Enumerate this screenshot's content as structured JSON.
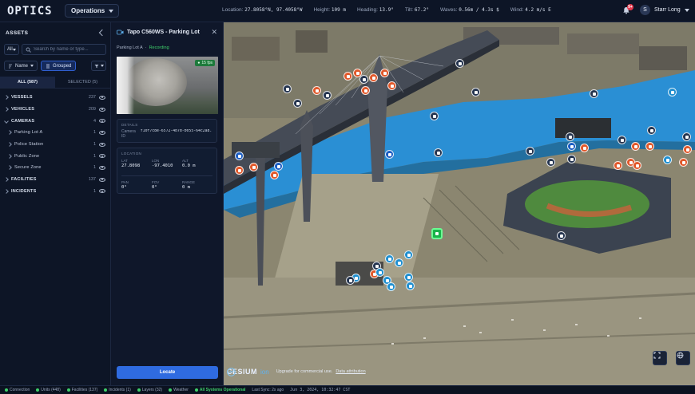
{
  "app": {
    "logo_text": "OPTICS",
    "operations_label": "Operations"
  },
  "telemetry": {
    "location_label": "Location:",
    "location_value": "27.8058°N, 97.4058°W",
    "height_label": "Height:",
    "height_value": "109 m",
    "heading_label": "Heading:",
    "heading_value": "13.9°",
    "tilt_label": "Tilt:",
    "tilt_value": "67.2°",
    "waves_label": "Waves:",
    "waves_value": "0.56m / 4.3s $",
    "wind_label": "Wind:",
    "wind_value": "4.2 m/s E"
  },
  "user": {
    "notification_count": "9+",
    "avatar_initial": "S",
    "name": "Starr Long"
  },
  "assets": {
    "title": "ASSETS",
    "filter_select": "All",
    "search_placeholder": "Search by name or type...",
    "sort_label": "Name",
    "grouped_label": "Grouped",
    "tabs": [
      {
        "label": "ALL (587)"
      },
      {
        "label": "SELECTED (5)"
      }
    ],
    "tree": [
      {
        "name": "VESSELS",
        "count": "237"
      },
      {
        "name": "VEHICLES",
        "count": "209"
      },
      {
        "name": "CAMERAS",
        "count": "4"
      },
      {
        "name": "Parking Lot A",
        "count": "1"
      },
      {
        "name": "Police Station",
        "count": "1"
      },
      {
        "name": "Public Zone",
        "count": "1"
      },
      {
        "name": "Secure Zone",
        "count": "1"
      },
      {
        "name": "FACILITIES",
        "count": "137"
      },
      {
        "name": "INCIDENTS",
        "count": "1"
      }
    ]
  },
  "camera": {
    "title": "Tapo C560WS - Parking Lot",
    "location": "Parking Lot A",
    "status": "Recording",
    "fps": "15 fps",
    "details_label": "DETAILS",
    "camera_id_label": "Camera ID",
    "camera_id_value": "f10f7c8e-6572-4b7d-b055-64c2a8...",
    "location_section_label": "LOCATION",
    "lat_label": "LAT",
    "lat_value": "27.8098",
    "lon_label": "LON",
    "lon_value": "-97.4010",
    "alt_label": "ALT",
    "alt_value": "0.0 m",
    "pan_label": "PAN",
    "pan_value": "0°",
    "fov_label": "FOV",
    "fov_value": "0°",
    "range_label": "RANGE",
    "range_value": "0 m",
    "locate_label": "Locate"
  },
  "map": {
    "cesium_brand": "CESIUM",
    "cesium_ion": "ion",
    "upgrade_text": "Upgrade for commercial use.",
    "attribution_text": "Data attribution"
  },
  "status": {
    "connection": "Connection",
    "units": "Units (448)",
    "facilities": "Facilities (137)",
    "incidents": "Incidents (1)",
    "layers": "Layers (32)",
    "weather": "Weather",
    "systems": "All Systems Operational",
    "last_sync": "Last Sync: 2s ago",
    "datetime": "Jun 3, 2024, 10:32:47 CST"
  },
  "colors": {
    "accent_blue": "#2f6be0",
    "recording_green": "#3fd06b",
    "marker_orange": "#e1582a",
    "water": "#2a8fd4"
  }
}
